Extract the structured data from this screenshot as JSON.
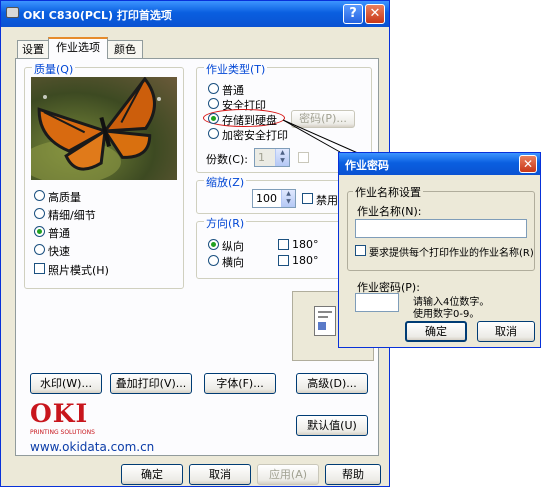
{
  "window": {
    "title": "OKI C830(PCL) 打印首选项",
    "help_btn": "?",
    "close_btn": "✕"
  },
  "tabs": [
    {
      "label": "设置"
    },
    {
      "label": "作业选项"
    },
    {
      "label": "颜色"
    }
  ],
  "quality": {
    "group_label": "质量(Q)",
    "options": [
      {
        "label": "高质量",
        "selected": false
      },
      {
        "label": "精细/细节",
        "selected": false
      },
      {
        "label": "普通",
        "selected": true
      },
      {
        "label": "快速",
        "selected": false
      }
    ],
    "photo_mode": "照片模式(H)"
  },
  "job_type": {
    "group_label": "作业类型(T)",
    "options": [
      {
        "label": "普通",
        "selected": false
      },
      {
        "label": "安全打印",
        "selected": false
      },
      {
        "label": "存储到硬盘",
        "selected": true
      },
      {
        "label": "加密安全打印",
        "selected": false
      }
    ],
    "password_btn": "密码(P)...",
    "copies_label": "份数(C):",
    "copies_value": "1"
  },
  "scale": {
    "group_label": "缩放(Z)",
    "value": "100",
    "disable_label": "禁用"
  },
  "orientation": {
    "group_label": "方向(R)",
    "portrait": "纵向",
    "landscape": "横向",
    "rotate1": "180°",
    "rotate2": "180°"
  },
  "buttons": {
    "watermark": "水印(W)...",
    "overlay": "叠加打印(V)...",
    "font": "字体(F)...",
    "advanced": "高级(D)...",
    "defaults": "默认值(U)"
  },
  "brand": {
    "logo": "OKI",
    "tagline": "PRINTING SOLUTIONS",
    "url": "www.okidata.com.cn"
  },
  "footer": {
    "ok": "确定",
    "cancel": "取消",
    "apply": "应用(A)",
    "help": "帮助"
  },
  "dialog": {
    "title": "作业密码",
    "close_btn": "✕",
    "job_name_group": "作业名称设置",
    "job_name_label": "作业名称(N):",
    "job_name_value": "",
    "require_name": "要求提供每个打印作业的作业名称(R)",
    "password_label": "作业密码(P):",
    "password_value": "",
    "hint1": "请输入4位数字。",
    "hint2": "使用数字0-9。",
    "ok": "确定",
    "cancel": "取消"
  }
}
